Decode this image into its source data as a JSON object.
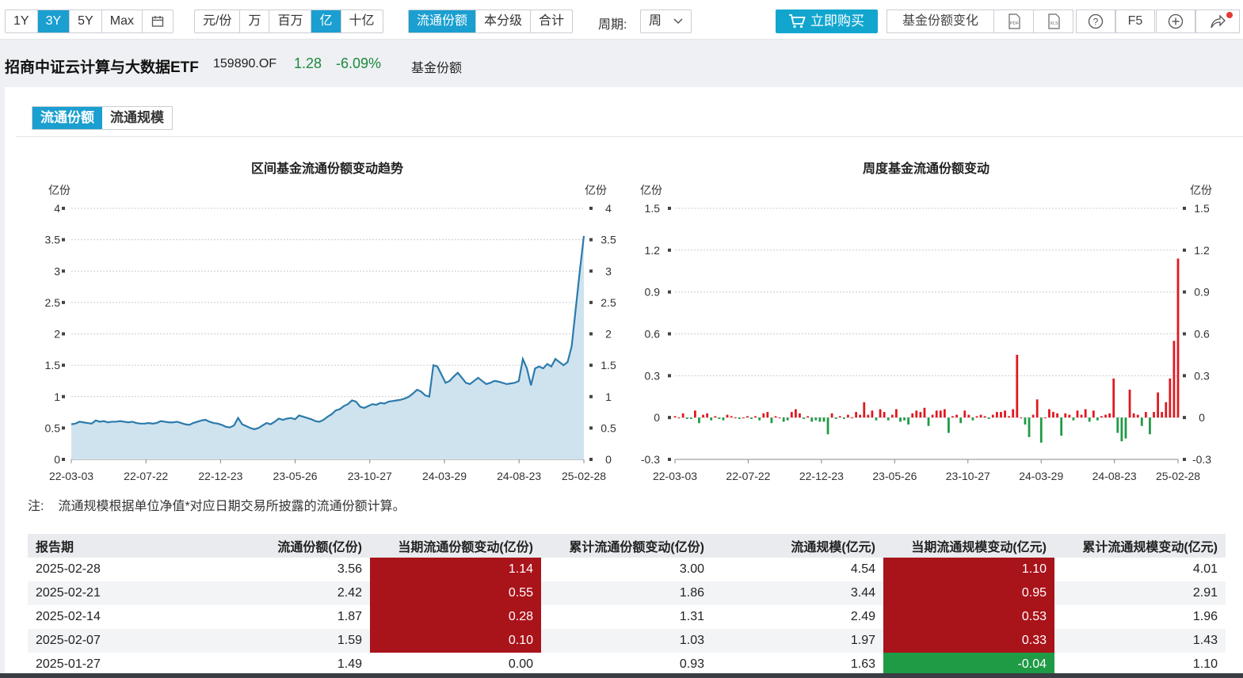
{
  "toolbar": {
    "ranges": [
      "1Y",
      "3Y",
      "5Y",
      "Max"
    ],
    "range_active": "3Y",
    "calendar_icon": "calendar-icon",
    "units": [
      "元/份",
      "万",
      "百万",
      "亿",
      "十亿"
    ],
    "unit_active": "亿",
    "modes": [
      "流通份额",
      "本分级",
      "合计"
    ],
    "mode_active": "流通份额",
    "period_label": "周期:",
    "period_value": "周",
    "buy_label": "立即购买",
    "change_label": "基金份额变化",
    "f5_label": "F5",
    "icons": [
      "pdf-icon",
      "xls-icon",
      "help-icon",
      "plus-circle-icon",
      "share-icon"
    ]
  },
  "fund": {
    "name": "招商中证云计算与大数据ETF",
    "code": "159890.OF",
    "price": "1.28",
    "change": "-6.09%",
    "tag": "基金份额"
  },
  "subtabs": [
    "流通份额",
    "流通规模"
  ],
  "subtab_active": "流通份额",
  "colors": {
    "accent": "#1a9fd0",
    "up": "#e0181f",
    "down": "#1f9a45",
    "line": "#2b7bab",
    "area": "#cfe3ef"
  },
  "chart_data": [
    {
      "type": "area",
      "title": "区间基金流通份额变动趋势",
      "ylabel": "亿份",
      "ylim": [
        0,
        4
      ],
      "yticks": [
        "0",
        "0.5",
        "1",
        "1.5",
        "2",
        "2.5",
        "3",
        "3.5",
        "4"
      ],
      "xticks": [
        "22-03-03",
        "22-07-22",
        "22-12-23",
        "23-05-26",
        "23-10-27",
        "24-03-29",
        "24-08-23",
        "25-02-28"
      ],
      "grid": true,
      "values": [
        0.56,
        0.57,
        0.6,
        0.59,
        0.58,
        0.57,
        0.62,
        0.6,
        0.61,
        0.59,
        0.6,
        0.6,
        0.61,
        0.6,
        0.59,
        0.6,
        0.58,
        0.57,
        0.57,
        0.58,
        0.57,
        0.58,
        0.61,
        0.6,
        0.59,
        0.59,
        0.6,
        0.58,
        0.56,
        0.55,
        0.58,
        0.6,
        0.62,
        0.63,
        0.6,
        0.58,
        0.57,
        0.55,
        0.52,
        0.51,
        0.54,
        0.66,
        0.56,
        0.53,
        0.5,
        0.48,
        0.5,
        0.54,
        0.58,
        0.56,
        0.6,
        0.65,
        0.63,
        0.65,
        0.66,
        0.64,
        0.7,
        0.68,
        0.66,
        0.64,
        0.61,
        0.6,
        0.63,
        0.68,
        0.72,
        0.78,
        0.8,
        0.85,
        0.88,
        0.94,
        0.92,
        0.84,
        0.82,
        0.85,
        0.88,
        0.87,
        0.9,
        0.89,
        0.92,
        0.93,
        0.94,
        0.95,
        0.97,
        1.0,
        1.05,
        1.11,
        1.08,
        1.02,
        1.0,
        1.5,
        1.48,
        1.35,
        1.22,
        1.25,
        1.32,
        1.38,
        1.3,
        1.22,
        1.2,
        1.25,
        1.3,
        1.25,
        1.2,
        1.22,
        1.25,
        1.24,
        1.22,
        1.2,
        1.21,
        1.22,
        1.25,
        1.6,
        1.45,
        1.18,
        1.45,
        1.48,
        1.45,
        1.52,
        1.48,
        1.6,
        1.55,
        1.5,
        1.55,
        1.8,
        2.4,
        3.0,
        3.56
      ]
    },
    {
      "type": "bar",
      "title": "周度基金流通份额变动",
      "ylabel": "亿份",
      "ylim": [
        -0.3,
        1.5
      ],
      "yticks": [
        "-0.3",
        "0",
        "0.3",
        "0.6",
        "0.9",
        "1.2",
        "1.5"
      ],
      "xticks": [
        "22-03-03",
        "22-07-22",
        "22-12-23",
        "23-05-26",
        "23-10-27",
        "24-03-29",
        "24-08-23",
        "25-02-28"
      ],
      "grid": true,
      "values": [
        0.01,
        0.0,
        0.03,
        -0.01,
        -0.01,
        0.05,
        -0.04,
        0.02,
        0.03,
        -0.02,
        0.01,
        -0.01,
        -0.02,
        0.02,
        0.01,
        0.0,
        -0.01,
        0.0,
        0.01,
        -0.01,
        0.01,
        -0.02,
        0.03,
        0.04,
        -0.04,
        0.01,
        0.0,
        -0.03,
        -0.02,
        0.04,
        0.06,
        0.03,
        -0.01,
        0.01,
        -0.03,
        -0.02,
        -0.03,
        -0.03,
        -0.12,
        0.03,
        -0.01,
        0.01,
        -0.01,
        0.02,
        0.0,
        0.04,
        0.02,
        0.11,
        0.02,
        0.05,
        -0.02,
        0.06,
        0.04,
        -0.02,
        0.02,
        0.06,
        -0.03,
        -0.02,
        -0.05,
        0.03,
        0.05,
        0.04,
        0.07,
        -0.06,
        0.02,
        0.05,
        0.05,
        0.06,
        -0.11,
        0.01,
        0.02,
        -0.04,
        0.05,
        0.02,
        -0.02,
        0.01,
        0.02,
        0.01,
        -0.01,
        0.02,
        0.04,
        0.04,
        0.05,
        0.01,
        0.06,
        0.45,
        0.0,
        -0.05,
        -0.14,
        0.02,
        0.13,
        -0.18,
        0.0,
        0.06,
        0.04,
        0.03,
        -0.13,
        0.03,
        0.02,
        -0.02,
        0.05,
        0.02,
        0.06,
        -0.03,
        0.05,
        -0.02,
        0.01,
        0.02,
        0.03,
        0.28,
        -0.11,
        -0.17,
        -0.15,
        0.2,
        0.03,
        0.02,
        -0.06,
        0.04,
        -0.12,
        0.04,
        0.18,
        0.04,
        0.11,
        0.28,
        0.55,
        1.14
      ]
    }
  ],
  "note": {
    "label": "注:",
    "text": "流通规模根据单位净值*对应日期交易所披露的流通份额计算。"
  },
  "table": {
    "headers": [
      "报告期",
      "流通份额(亿份)",
      "当期流通份额变动(亿份)",
      "累计流通份额变动(亿份)",
      "流通规模(亿元)",
      "当期流通规模变动(亿元)",
      "累计流通规模变动(亿元)"
    ],
    "rows": [
      [
        "2025-02-28",
        "3.56",
        "1.14",
        "3.00",
        "4.54",
        "1.10",
        "4.01"
      ],
      [
        "2025-02-21",
        "2.42",
        "0.55",
        "1.86",
        "3.44",
        "0.95",
        "2.91"
      ],
      [
        "2025-02-14",
        "1.87",
        "0.28",
        "1.31",
        "2.49",
        "0.53",
        "1.96"
      ],
      [
        "2025-02-07",
        "1.59",
        "0.10",
        "1.03",
        "1.97",
        "0.33",
        "1.43"
      ],
      [
        "2025-01-27",
        "1.49",
        "0.00",
        "0.93",
        "1.63",
        "-0.04",
        "1.10"
      ]
    ]
  }
}
